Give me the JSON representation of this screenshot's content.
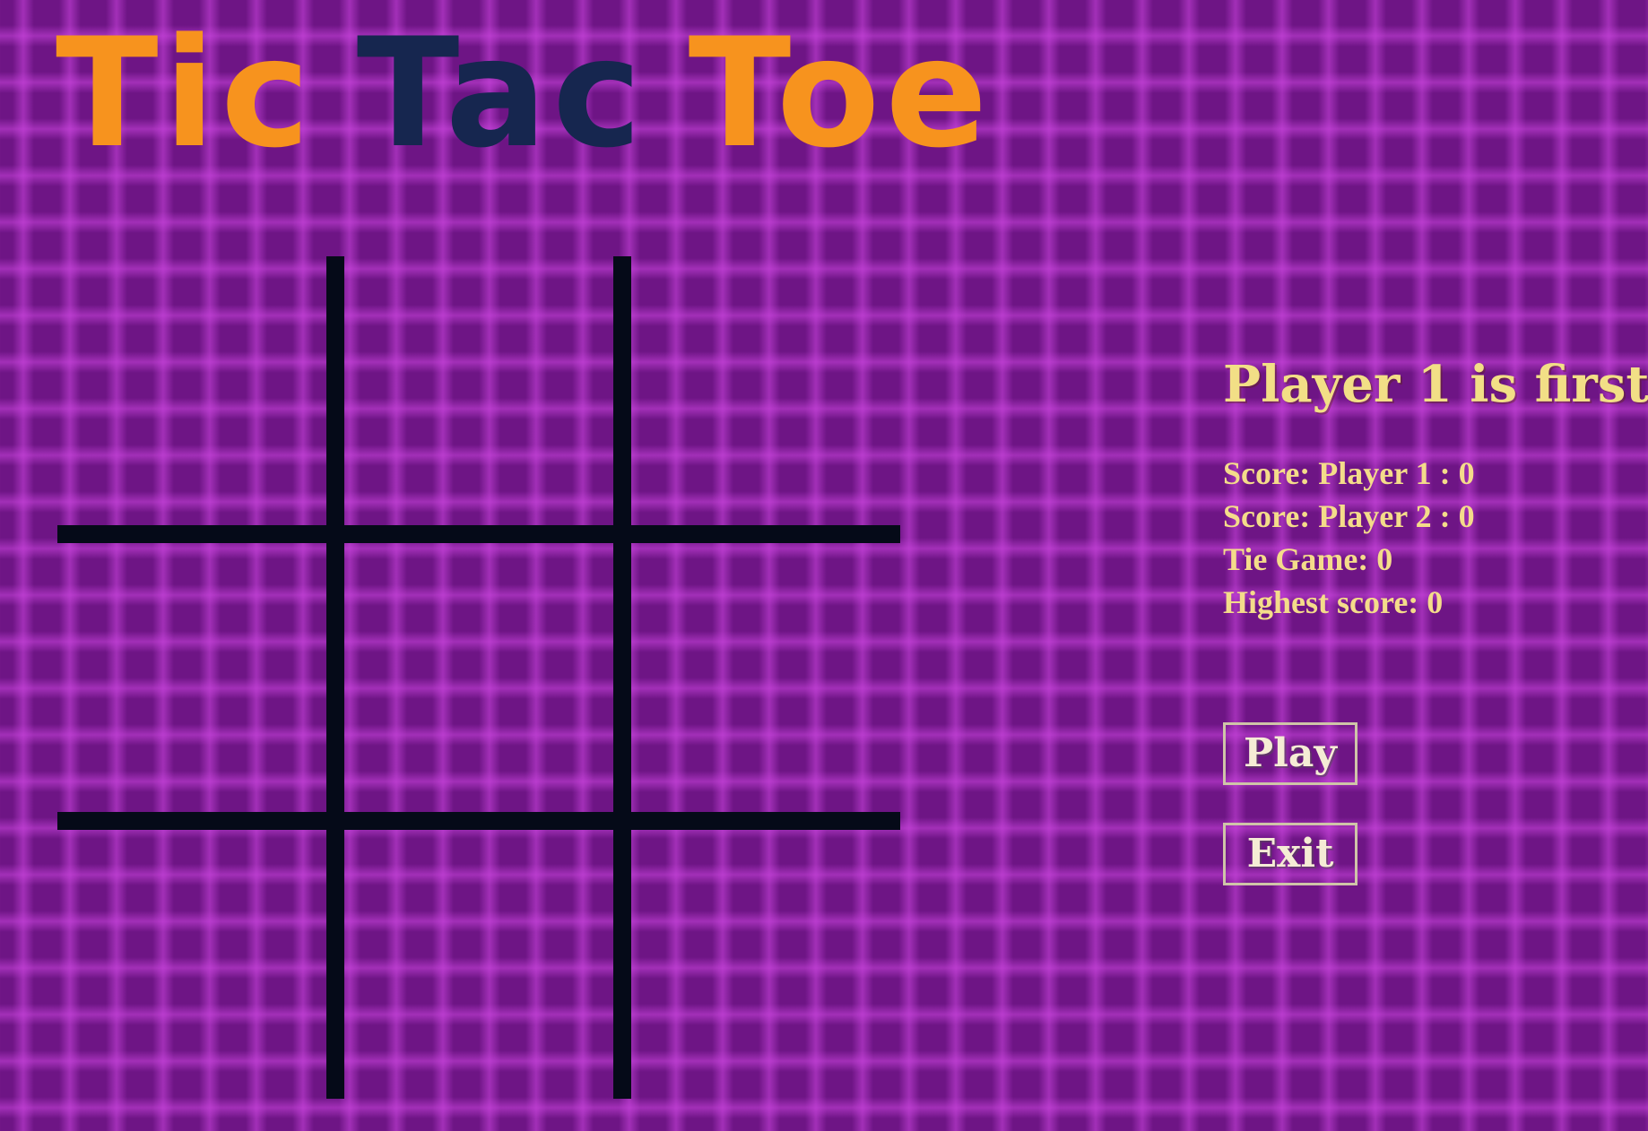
{
  "title": {
    "word1": "Tic",
    "word2": "Tac",
    "word3": "Toe",
    "colors": {
      "primary": "#f7931e",
      "secondary": "#16264f"
    }
  },
  "board": {
    "cells": [
      "",
      "",
      "",
      "",
      "",
      "",
      "",
      "",
      ""
    ],
    "line_color": "#050a18"
  },
  "status": "Player 1 is first",
  "scores": {
    "player1": "Score: Player 1 : 0",
    "player2": "Score: Player 2 : 0",
    "tie": "Tie Game: 0",
    "highest": "Highest score: 0"
  },
  "buttons": {
    "play": "Play",
    "exit": "Exit"
  },
  "colors": {
    "background": "#6e1585",
    "text": "#f4dc8a"
  }
}
